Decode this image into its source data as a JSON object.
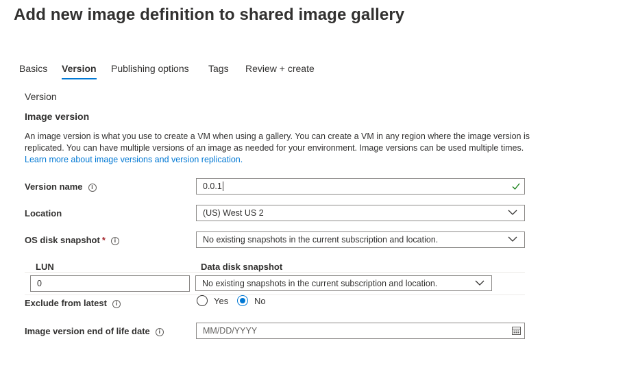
{
  "page": {
    "title": "Add new image definition to shared image gallery"
  },
  "tabs": [
    {
      "label": "Basics",
      "active": false
    },
    {
      "label": "Version",
      "active": true
    },
    {
      "label": "Publishing options",
      "active": false
    },
    {
      "label": "Tags",
      "active": false
    },
    {
      "label": "Review + create",
      "active": false
    }
  ],
  "content": {
    "heading": "Version",
    "section_title": "Image version",
    "description": "An image version is what you use to create a VM when using a gallery. You can create a VM in any region where the image version is replicated. You can have multiple versions of an image as needed for your environment. Image versions can be used multiple times.",
    "learn_more": "Learn more about image versions and version replication."
  },
  "form": {
    "version_name": {
      "label": "Version name",
      "value": "0.0.1"
    },
    "location": {
      "label": "Location",
      "value": "(US) West US 2"
    },
    "os_disk_snapshot": {
      "label": "OS disk snapshot",
      "required_marker": "*",
      "value": "No existing snapshots in the current subscription and location."
    },
    "data_disks": {
      "lun_header": "LUN",
      "snapshot_header": "Data disk snapshot",
      "lun_value": "0",
      "snapshot_value": "No existing snapshots in the current subscription and location."
    },
    "exclude_from_latest": {
      "label": "Exclude from latest",
      "options": [
        {
          "label": "Yes",
          "selected": false
        },
        {
          "label": "No",
          "selected": true
        }
      ]
    },
    "end_of_life": {
      "label": "Image version end of life date",
      "placeholder": "MM/DD/YYYY"
    }
  },
  "icons": {
    "info": "info-icon",
    "dropdown": "chevron-down-icon",
    "valid": "checkmark-icon",
    "calendar": "calendar-icon"
  },
  "colors": {
    "accent": "#0078d4",
    "valid": "#107c10",
    "required": "#a4262c"
  }
}
